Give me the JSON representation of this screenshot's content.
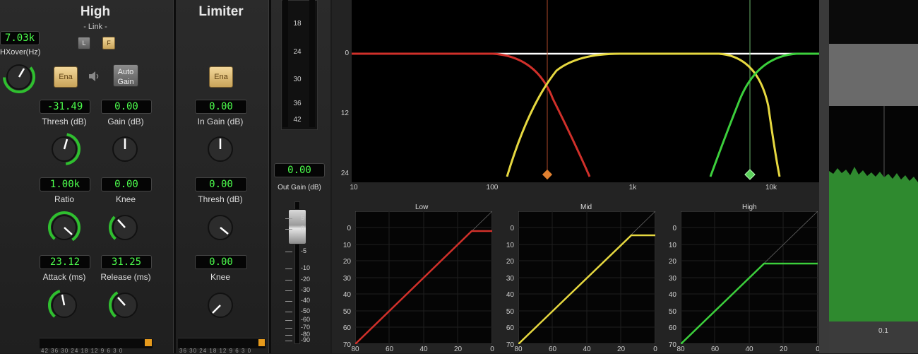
{
  "high": {
    "title": "High",
    "link_label": "- Link -",
    "link_l": "L",
    "link_f": "F",
    "xover_value": "7.03k",
    "xover_label": "HXover(Hz)",
    "ena": "Ena",
    "auto_gain": "Auto\nGain",
    "thresh_value": "-31.49",
    "thresh_label": "Thresh (dB)",
    "gain_value": "0.00",
    "gain_label": "Gain (dB)",
    "ratio_value": "1.00k",
    "ratio_label": "Ratio",
    "knee_value": "0.00",
    "knee_label": "Knee",
    "attack_value": "23.12",
    "attack_label": "Attack (ms)",
    "release_value": "31.25",
    "release_label": "Release (ms)",
    "meter_scale": "42 36 30 24 18 12 9 6 3 0"
  },
  "limiter": {
    "title": "Limiter",
    "ena": "Ena",
    "in_gain_value": "0.00",
    "in_gain_label": "In Gain (dB)",
    "thresh_value": "0.00",
    "thresh_label": "Thresh (dB)",
    "knee_value": "0.00",
    "knee_label": "Knee",
    "meter_scale": "36 30 24 18 12 9 6 3 0"
  },
  "output": {
    "scale_top": [
      "18",
      "24",
      "30",
      "36",
      "42"
    ],
    "gain_value": "0.00",
    "gain_label": "Out Gain (dB)",
    "fader_scale": [
      "5",
      "0",
      "-5",
      "-10",
      "-20",
      "-30",
      "-40",
      "-50",
      "-60",
      "-70",
      "-80",
      "-90"
    ]
  },
  "eq_graph": {
    "y_labels": [
      "0",
      "12",
      "24"
    ],
    "x_labels": [
      "10",
      "100",
      "1k",
      "10k"
    ]
  },
  "comp_graphs": [
    {
      "title": "Low",
      "y_labels": [
        "0",
        "10",
        "20",
        "30",
        "40",
        "50",
        "60",
        "70"
      ],
      "x_labels": [
        "80",
        "60",
        "40",
        "20",
        "0"
      ]
    },
    {
      "title": "Mid",
      "y_labels": [
        "0",
        "10",
        "20",
        "30",
        "40",
        "50",
        "60",
        "70"
      ],
      "x_labels": [
        "80",
        "60",
        "40",
        "20",
        "0"
      ]
    },
    {
      "title": "High",
      "y_labels": [
        "0",
        "10",
        "20",
        "30",
        "40",
        "50",
        "60",
        "70"
      ],
      "x_labels": [
        "80",
        "60",
        "40",
        "20",
        "0"
      ]
    }
  ],
  "analyzer": {
    "x_label": "0.1"
  },
  "colors": {
    "accent_green": "#4dff4d",
    "low_band": "#d0302a",
    "mid_band": "#e6d840",
    "high_band": "#3ccf3c",
    "knob_arc": "#2fbf2f"
  }
}
